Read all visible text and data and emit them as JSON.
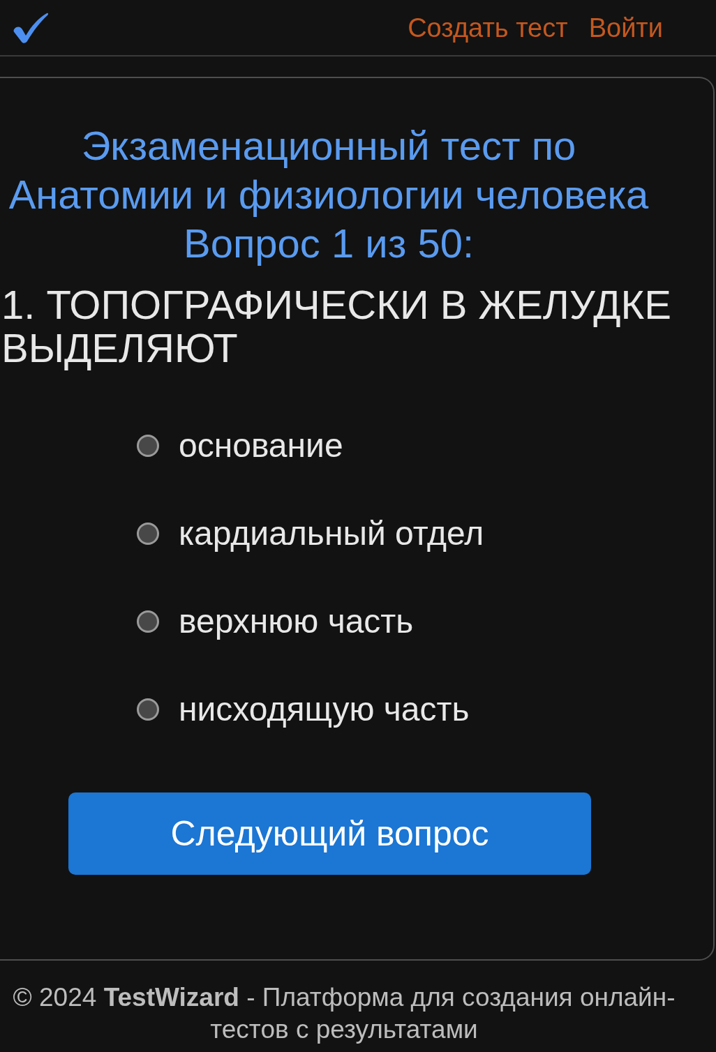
{
  "header": {
    "nav": [
      {
        "label": "Создать тест"
      },
      {
        "label": "Войти"
      }
    ]
  },
  "quiz": {
    "title": "Экзаменационный тест по Анатомии и физиологии человека",
    "progress": "Вопрос 1 из 50:",
    "question": "1. ТОПОГРАФИЧЕСКИ В ЖЕЛУДКЕ ВЫДЕЛЯЮТ",
    "options": [
      {
        "label": "основание",
        "selected": false
      },
      {
        "label": "кардиальный отдел",
        "selected": false
      },
      {
        "label": "верхнюю часть",
        "selected": false
      },
      {
        "label": "нисходящую часть",
        "selected": false
      }
    ],
    "next_button": "Следующий вопрос"
  },
  "footer": {
    "text": "© 2024 **TestWizard** - Платформа для создания онлайн-тестов с результатами"
  }
}
